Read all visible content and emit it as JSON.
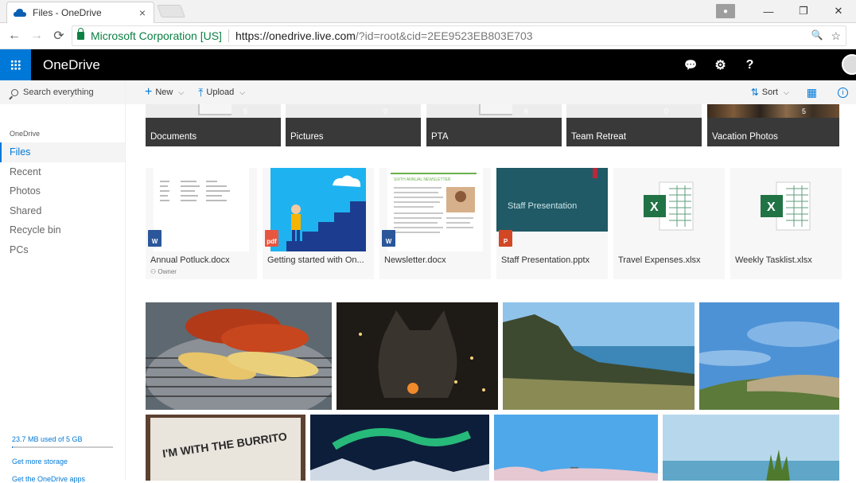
{
  "browser": {
    "tab_title": "Files - OneDrive",
    "tab_close": "×",
    "ev_cert": "Microsoft Corporation [US]",
    "url_host": "https://onedrive.live.com",
    "url_rest": "/?id=root&cid=2EE9523EB803E703",
    "window_controls": [
      "—",
      "❐",
      "✕"
    ],
    "nav": {
      "back": "←",
      "forward": "→",
      "reload": "⟳"
    },
    "omni_icons": [
      "🔍",
      "☆"
    ]
  },
  "header": {
    "brand": "OneDrive",
    "icons": [
      "chat-icon",
      "gear-icon",
      "help-icon"
    ],
    "chat_glyph": "💬",
    "gear_glyph": "⚙",
    "help_glyph": "?"
  },
  "sidebar": {
    "search_placeholder": "Search everything",
    "section": "OneDrive",
    "items": [
      {
        "label": "Files",
        "active": true
      },
      {
        "label": "Recent"
      },
      {
        "label": "Photos"
      },
      {
        "label": "Shared"
      },
      {
        "label": "Recycle bin"
      },
      {
        "label": "PCs"
      }
    ],
    "storage": "23.7 MB used of 5 GB",
    "storage_fraction": 0.005,
    "get_storage": "Get more storage",
    "get_apps": "Get the OneDrive apps"
  },
  "commandbar": {
    "new_label": "New",
    "upload_label": "Upload",
    "sort_label": "Sort"
  },
  "folders": [
    {
      "name": "Documents",
      "count": "5"
    },
    {
      "name": "Pictures",
      "count": "0"
    },
    {
      "name": "PTA",
      "count": "6"
    },
    {
      "name": "Team Retreat",
      "count": "0"
    },
    {
      "name": "Vacation Photos",
      "count": "5"
    }
  ],
  "files": [
    {
      "name": "Annual Potluck.docx",
      "owner": "Owner",
      "type": "word"
    },
    {
      "name": "Getting started with On...",
      "type": "pdf"
    },
    {
      "name": "Newsletter.docx",
      "type": "word"
    },
    {
      "name": "Staff Presentation.pptx",
      "type": "ppt",
      "thumb_text": "Staff Presentation"
    },
    {
      "name": "Travel Expenses.xlsx",
      "type": "excel"
    },
    {
      "name": "Weekly Tasklist.xlsx",
      "type": "excel"
    }
  ],
  "thumb_texts": {
    "newsletter": "SIXTH ANNUAL NEWSLETTER",
    "burrito": "I'M WITH THE BURRITO"
  },
  "colors": {
    "accent": "#0078d7",
    "header_bg": "#000000",
    "folder_label": "#393939",
    "word": "#2b579a",
    "excel": "#217346",
    "ppt": "#d24726",
    "pdf": "#e8563f"
  }
}
